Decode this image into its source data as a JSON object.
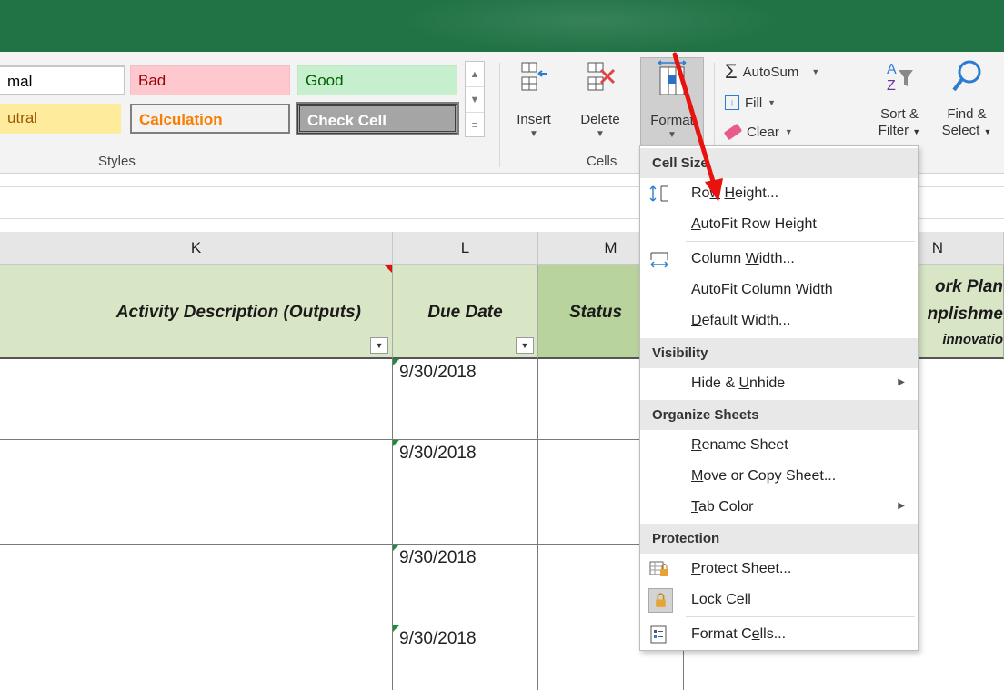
{
  "styles_gallery": {
    "normal": "mal",
    "bad": "Bad",
    "good": "Good",
    "neutral": "utral",
    "calculation": "Calculation",
    "check_cell": "Check Cell",
    "group_label": "Styles"
  },
  "cells_group": {
    "insert_label": "Insert",
    "delete_label": "Delete",
    "format_label": "Format",
    "group_label": "Cells"
  },
  "editing_group": {
    "autosum_label": "AutoSum",
    "fill_label": "Fill",
    "clear_label": "Clear",
    "sort_label_1": "Sort &",
    "sort_label_2": "Filter",
    "find_label_1": "Find &",
    "find_label_2": "Select"
  },
  "columns": {
    "k": "K",
    "l": "L",
    "m": "M",
    "n": "N"
  },
  "table_headers": {
    "k": "Activity Description (Outputs)",
    "l": "Due Date",
    "m": "Status",
    "n_line1": "ork Plan",
    "n_line2": "nplishme",
    "n_line3": "innovatio"
  },
  "rows": [
    {
      "due_date": "9/30/2018"
    },
    {
      "due_date": "9/30/2018"
    },
    {
      "due_date": "9/30/2018"
    },
    {
      "due_date": "9/30/2018"
    }
  ],
  "format_menu": {
    "cell_size_header": "Cell Size",
    "row_height_pre": "Ro",
    "row_height_u": "w",
    "row_height_mid": " ",
    "row_height_u2": "H",
    "row_height_post": "eight...",
    "autofit_row_u": "A",
    "autofit_row_post": "utoFit Row Height",
    "column_width_pre": "Column ",
    "column_width_u": "W",
    "column_width_post": "idth...",
    "autofit_col_pre": "AutoF",
    "autofit_col_u": "i",
    "autofit_col_post": "t Column Width",
    "default_width_u": "D",
    "default_width_post": "efault Width...",
    "visibility_header": "Visibility",
    "hide_unhide_pre": "Hide & ",
    "hide_unhide_u": "U",
    "hide_unhide_post": "nhide",
    "organize_header": "Organize Sheets",
    "rename_u": "R",
    "rename_post": "ename Sheet",
    "move_u": "M",
    "move_post": "ove or Copy Sheet...",
    "tab_color_u": "T",
    "tab_color_post": "ab Color",
    "protection_header": "Protection",
    "protect_u": "P",
    "protect_post": "rotect Sheet...",
    "lock_u": "L",
    "lock_post": "ock Cell",
    "format_cells_pre": "Format C",
    "format_cells_u": "e",
    "format_cells_post": "lls..."
  },
  "colors": {
    "title_bar": "#217346",
    "header_fill": "#d9e6c6",
    "annotation_arrow": "#e8130f"
  }
}
